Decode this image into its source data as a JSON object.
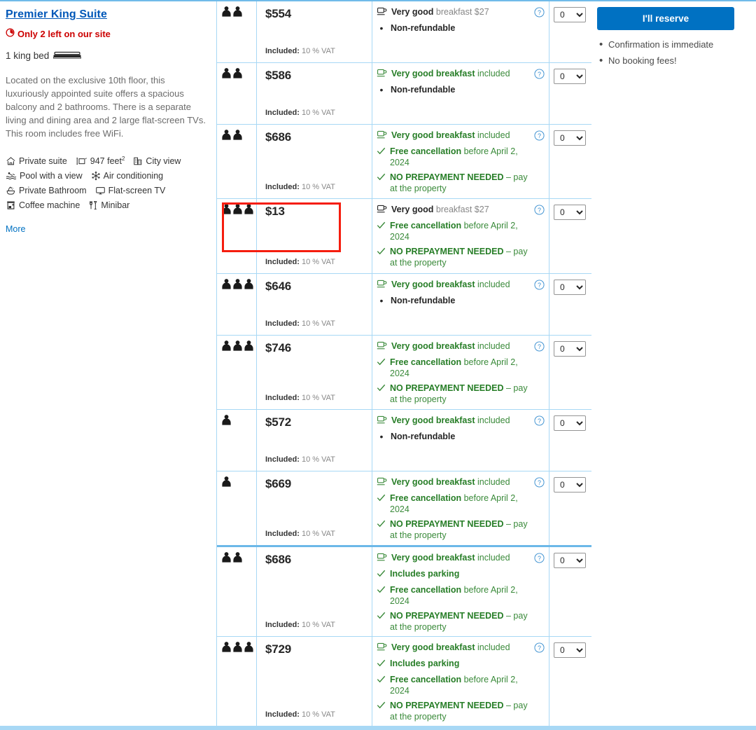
{
  "room": {
    "title": "Premier King Suite",
    "scarcity": "Only 2 left on our site",
    "scarcity_icon": "clock-icon",
    "bed": "1 king bed",
    "bed_icon": "bed-icon",
    "description": "Located on the exclusive 10th floor, this luxuriously appointed suite offers a spacious balcony and 2 bathrooms. There is a separate living and dining area and 2 large flat-screen TVs. This room includes free WiFi.",
    "facilities": [
      [
        {
          "label": "Private suite",
          "icon": "private-suite-icon"
        },
        {
          "label": "947 feet",
          "sup": "2",
          "icon": "area-size-icon"
        },
        {
          "label": "City view",
          "icon": "city-view-icon"
        }
      ],
      [
        {
          "label": "Pool with a view",
          "icon": "pool-icon"
        },
        {
          "label": "Air conditioning",
          "icon": "air-conditioning-icon"
        }
      ],
      [
        {
          "label": "Private Bathroom",
          "icon": "bathroom-icon"
        },
        {
          "label": "Flat-screen TV",
          "icon": "tv-icon"
        }
      ],
      [
        {
          "label": "Coffee machine",
          "icon": "coffee-machine-icon"
        },
        {
          "label": "Minibar",
          "icon": "minibar-icon"
        }
      ]
    ],
    "more_label": "More"
  },
  "colors": {
    "link_blue": "#0057b8",
    "accent_blue": "#0071c2",
    "table_border_blue": "#a8d8f5",
    "green": "#267d26",
    "scarcity_red": "#cc0000",
    "annotation_red": "#f51d0e"
  },
  "table": {
    "vat_label": "Included:",
    "vat_value": "10 % VAT",
    "help_icon": "help-circle-icon",
    "select_value": "0",
    "select_options": [
      "0",
      "1",
      "2"
    ],
    "rows": [
      {
        "occupancy": 2,
        "price": "$554",
        "vat": "10 % VAT",
        "highlighted": false,
        "group_break": false,
        "options": [
          {
            "style": "dark",
            "icon": "coffee-cup-icon",
            "bold": "Very good",
            "rest": " breakfast $27"
          },
          {
            "style": "bullet",
            "icon": "bullet-dot",
            "bold": "Non-refundable",
            "rest": ""
          }
        ]
      },
      {
        "occupancy": 2,
        "price": "$586",
        "vat": "10 % VAT",
        "highlighted": false,
        "group_break": false,
        "options": [
          {
            "style": "green",
            "icon": "coffee-cup-icon",
            "bold": "Very good breakfast",
            "rest": " included"
          },
          {
            "style": "bullet",
            "icon": "bullet-dot",
            "bold": "Non-refundable",
            "rest": ""
          }
        ]
      },
      {
        "occupancy": 2,
        "price": "$686",
        "vat": "10 % VAT",
        "highlighted": false,
        "group_break": false,
        "options": [
          {
            "style": "green",
            "icon": "coffee-cup-icon",
            "bold": "Very good breakfast",
            "rest": " included"
          },
          {
            "style": "green",
            "icon": "check-icon",
            "bold": "Free cancellation",
            "rest": " before April 2, 2024"
          },
          {
            "style": "green",
            "icon": "check-icon",
            "bold": "NO PREPAYMENT NEEDED",
            "rest": " – pay at the property"
          }
        ]
      },
      {
        "occupancy": 3,
        "price": "$13",
        "vat": "10 % VAT",
        "highlighted": true,
        "group_break": false,
        "options": [
          {
            "style": "dark",
            "icon": "coffee-cup-icon",
            "bold": "Very good",
            "rest": " breakfast $27"
          },
          {
            "style": "green",
            "icon": "check-icon",
            "bold": "Free cancellation",
            "rest": " before April 2, 2024"
          },
          {
            "style": "green",
            "icon": "check-icon",
            "bold": "NO PREPAYMENT NEEDED",
            "rest": " – pay at the property"
          }
        ]
      },
      {
        "occupancy": 3,
        "price": "$646",
        "vat": "10 % VAT",
        "highlighted": false,
        "group_break": false,
        "options": [
          {
            "style": "green",
            "icon": "coffee-cup-icon",
            "bold": "Very good breakfast",
            "rest": " included"
          },
          {
            "style": "bullet",
            "icon": "bullet-dot",
            "bold": "Non-refundable",
            "rest": ""
          }
        ]
      },
      {
        "occupancy": 3,
        "price": "$746",
        "vat": "10 % VAT",
        "highlighted": false,
        "group_break": false,
        "options": [
          {
            "style": "green",
            "icon": "coffee-cup-icon",
            "bold": "Very good breakfast",
            "rest": " included"
          },
          {
            "style": "green",
            "icon": "check-icon",
            "bold": "Free cancellation",
            "rest": " before April 2, 2024"
          },
          {
            "style": "green",
            "icon": "check-icon",
            "bold": "NO PREPAYMENT NEEDED",
            "rest": " – pay at the property"
          }
        ]
      },
      {
        "occupancy": 1,
        "price": "$572",
        "vat": "10 % VAT",
        "highlighted": false,
        "group_break": false,
        "options": [
          {
            "style": "green",
            "icon": "coffee-cup-icon",
            "bold": "Very good breakfast",
            "rest": " included"
          },
          {
            "style": "bullet",
            "icon": "bullet-dot",
            "bold": "Non-refundable",
            "rest": ""
          }
        ]
      },
      {
        "occupancy": 1,
        "price": "$669",
        "vat": "10 % VAT",
        "highlighted": false,
        "group_break": true,
        "options": [
          {
            "style": "green",
            "icon": "coffee-cup-icon",
            "bold": "Very good breakfast",
            "rest": " included"
          },
          {
            "style": "green",
            "icon": "check-icon",
            "bold": "Free cancellation",
            "rest": " before April 2, 2024"
          },
          {
            "style": "green",
            "icon": "check-icon",
            "bold": "NO PREPAYMENT NEEDED",
            "rest": " – pay at the property"
          }
        ]
      },
      {
        "occupancy": 2,
        "price": "$686",
        "vat": "10 % VAT",
        "highlighted": false,
        "group_break": false,
        "options": [
          {
            "style": "green",
            "icon": "coffee-cup-icon",
            "bold": "Very good breakfast",
            "rest": " included"
          },
          {
            "style": "green",
            "icon": "check-icon",
            "bold": "Includes parking",
            "rest": ""
          },
          {
            "style": "green",
            "icon": "check-icon",
            "bold": "Free cancellation",
            "rest": " before April 2, 2024"
          },
          {
            "style": "green",
            "icon": "check-icon",
            "bold": "NO PREPAYMENT NEEDED",
            "rest": " – pay at the property"
          }
        ]
      },
      {
        "occupancy": 3,
        "price": "$729",
        "vat": "10 % VAT",
        "highlighted": false,
        "group_break": false,
        "options": [
          {
            "style": "green",
            "icon": "coffee-cup-icon",
            "bold": "Very good breakfast",
            "rest": " included"
          },
          {
            "style": "green",
            "icon": "check-icon",
            "bold": "Includes parking",
            "rest": ""
          },
          {
            "style": "green",
            "icon": "check-icon",
            "bold": "Free cancellation",
            "rest": " before April 2, 2024"
          },
          {
            "style": "green",
            "icon": "check-icon",
            "bold": "NO PREPAYMENT NEEDED",
            "rest": " – pay at the property"
          }
        ]
      }
    ]
  },
  "reserve": {
    "button_label": "I'll reserve",
    "notes": [
      "Confirmation is immediate",
      "No booking fees!"
    ]
  }
}
